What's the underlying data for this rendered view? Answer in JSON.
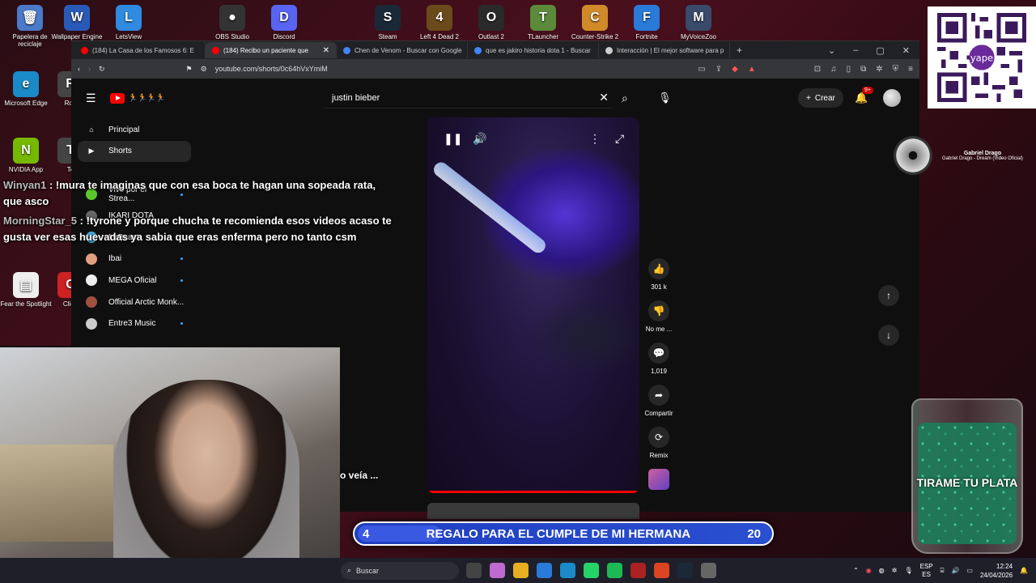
{
  "desktop": {
    "icons": [
      {
        "label": "Papelera de reciclaje",
        "color": "#4a7ac8",
        "glyph": "🗑"
      },
      {
        "label": "Wallpaper Engine",
        "color": "#2a5ab8",
        "glyph": "W"
      },
      {
        "label": "LetsView",
        "color": "#2f8ae0",
        "glyph": "L"
      },
      {
        "label": "OBS Studio",
        "color": "#333",
        "glyph": "●"
      },
      {
        "label": "Discord",
        "color": "#5865f2",
        "glyph": "D"
      },
      {
        "label": "Steam",
        "color": "#1b2838",
        "glyph": "S"
      },
      {
        "label": "Left 4 Dead 2",
        "color": "#6a4a1a",
        "glyph": "4"
      },
      {
        "label": "Outlast 2",
        "color": "#2a2a2a",
        "glyph": "O"
      },
      {
        "label": "TLauncher",
        "color": "#5a8a3a",
        "glyph": "T"
      },
      {
        "label": "Counter-Strike 2",
        "color": "#d08a2a",
        "glyph": "C"
      },
      {
        "label": "Fortnite",
        "color": "#2a7ad8",
        "glyph": "F"
      },
      {
        "label": "MyVoiceZoo",
        "color": "#3a4a6a",
        "glyph": "M"
      },
      {
        "label": "Microsoft Edge",
        "color": "#1a8ac8",
        "glyph": "e"
      },
      {
        "label": "Rob",
        "color": "#444",
        "glyph": "R"
      },
      {
        "label": "NVIDIA App",
        "color": "#76b900",
        "glyph": "N"
      },
      {
        "label": "Te",
        "color": "#444",
        "glyph": "T"
      },
      {
        "label": "Fear the Spotlight",
        "color": "#eee",
        "glyph": "▤"
      },
      {
        "label": "Clien",
        "color": "#c22",
        "glyph": "C"
      }
    ]
  },
  "browser": {
    "tabs": [
      {
        "title": "(184) La Casa de los Famosos 6: E",
        "fav": "#f00"
      },
      {
        "title": "(184) Recibo un paciente que",
        "fav": "#f00",
        "active": true
      },
      {
        "title": "Chen de Venom - Buscar con Google",
        "fav": "#4285f4"
      },
      {
        "title": "que es jakiro historia dota 1 - Buscar",
        "fav": "#4285f4"
      },
      {
        "title": "Interacción | El mejor software para p",
        "fav": "#ccc"
      }
    ],
    "url": "youtube.com/shorts/0c64hVxYmiM"
  },
  "youtube": {
    "search_value": "justin bieber",
    "create_label": "Crear",
    "notif_count": "9+",
    "sidebar": [
      {
        "label": "Principal",
        "icon": "home-icon",
        "glyph": "⌂",
        "color": "transparent"
      },
      {
        "label": "Shorts",
        "icon": "shorts-icon",
        "glyph": "▶",
        "color": "transparent",
        "active": true
      },
      {
        "label": "",
        "icon": "",
        "glyph": "",
        "color": "transparent"
      },
      {
        "label": "Vivo por el Strea...",
        "icon": "channel-avatar",
        "glyph": "",
        "color": "#5ac82a",
        "dot": true
      },
      {
        "label": "IKARI DOTA",
        "icon": "channel-avatar",
        "glyph": "",
        "color": "#666"
      },
      {
        "label": "MrBeast",
        "icon": "channel-avatar",
        "glyph": "",
        "color": "#4ab0e0"
      },
      {
        "label": "Ibai",
        "icon": "channel-avatar",
        "glyph": "",
        "color": "#e0a080",
        "dot": true
      },
      {
        "label": "MEGA Oficial",
        "icon": "channel-avatar",
        "glyph": "",
        "color": "#eee",
        "dot": true
      },
      {
        "label": "Official Arctic Monk...",
        "icon": "channel-avatar",
        "glyph": "",
        "color": "#a05040"
      },
      {
        "label": "Entre3 Music",
        "icon": "channel-avatar",
        "glyph": "",
        "color": "#ccc",
        "dot": true
      }
    ],
    "actions": [
      {
        "name": "like",
        "glyph": "👍",
        "label": "301 k"
      },
      {
        "name": "dislike",
        "glyph": "👎",
        "label": "No me ..."
      },
      {
        "name": "comments",
        "glyph": "💬",
        "label": "1,019"
      },
      {
        "name": "share",
        "glyph": "➦",
        "label": "Compartir"
      },
      {
        "name": "remix",
        "glyph": "⟳",
        "label": "Remix"
      }
    ]
  },
  "chat": [
    {
      "user": "Winyan1",
      "message": "!mura te imaginas que con esa boca te hagan una sopeada rata, que asco"
    },
    {
      "user": "MorningStar_5",
      "message": "!tyrone y porque chucha te recomienda esos videos acaso te gusta ver esas huevadas ya sabia que eras enferma pero no tanto csm"
    }
  ],
  "webcam_tail_text": "o veía ...",
  "goal": {
    "current": "4",
    "title": "REGALO PARA EL CUMPLE DE MI HERMANA",
    "target": "20",
    "progress": 0.2
  },
  "qr": {
    "brand": "yape"
  },
  "now_playing": {
    "artist": "Gabriel Drago",
    "track": "Gabriel Drago - Dream (Video Oficial)"
  },
  "jar": {
    "text": "TIRAME TU PLATA"
  },
  "taskbar": {
    "search_placeholder": "Buscar",
    "apps": [
      "#444",
      "#c06ad0",
      "#e8b020",
      "#2a7ad8",
      "#1a8ac8",
      "#25d366",
      "#1db954",
      "#aa2222",
      "#dd4422",
      "#1b2838",
      "#666"
    ],
    "lang_top": "ESP",
    "lang_bottom": "ES",
    "time": "12:24",
    "date": "24/04/2026"
  }
}
